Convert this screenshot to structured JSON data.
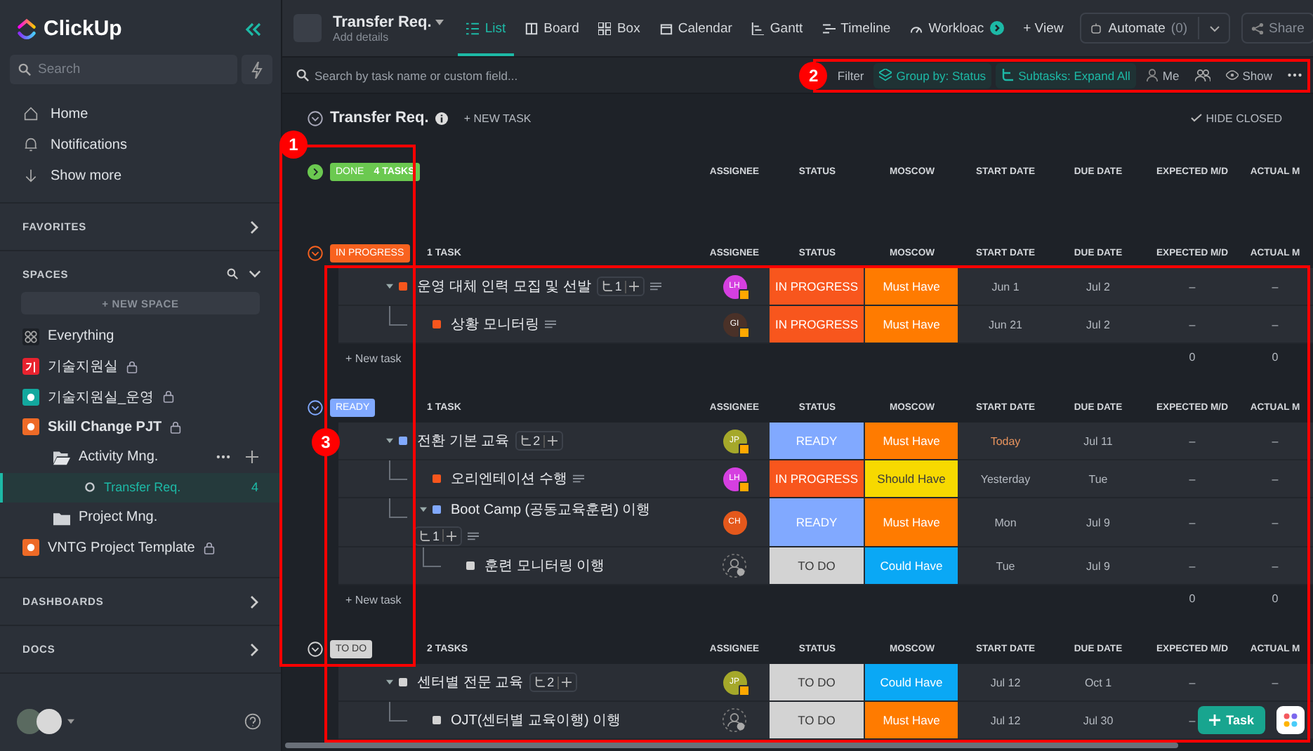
{
  "sidebar": {
    "logo": "ClickUp",
    "search": {
      "placeholder": "Search"
    },
    "nav": [
      {
        "label": "Home",
        "kind": "home"
      },
      {
        "label": "Notifications",
        "kind": "bell"
      },
      {
        "label": "Show more",
        "kind": "arrow"
      }
    ],
    "favorites": "FAVORITES",
    "spaces": {
      "title": "SPACES",
      "new_space": "+ NEW SPACE",
      "items": [
        {
          "kind": "everything",
          "label": "Everything",
          "locked": false,
          "selected": false,
          "hovered": false
        },
        {
          "kind": "space",
          "label": "기술지원실",
          "color": "#e8232f",
          "icon_text": "기",
          "locked": true,
          "selected": false,
          "hovered": false,
          "expanded": false
        },
        {
          "kind": "space",
          "label": "기술지원실_운영",
          "color": "#13a89e",
          "locked": true,
          "selected": false,
          "hovered": false,
          "expanded": false
        },
        {
          "kind": "space",
          "label": "Skill Change PJT",
          "color": "#ee6a27",
          "locked": true,
          "selected": false,
          "hovered": false,
          "expanded": true,
          "children": [
            {
              "kind": "folder",
              "label": "Activity Mng.",
              "locked": false,
              "selected": false,
              "hovered": true,
              "expanded": true,
              "children": [
                {
                  "kind": "list",
                  "label": "Transfer Req.",
                  "count": "4",
                  "locked": false,
                  "selected": true,
                  "hovered": false
                }
              ]
            },
            {
              "kind": "folder",
              "label": "Project Mng.",
              "locked": false,
              "selected": false,
              "hovered": false,
              "expanded": false
            }
          ]
        },
        {
          "kind": "space",
          "label": "VNTG Project Template",
          "color": "#ee6a27",
          "locked": true,
          "selected": false,
          "hovered": false,
          "expanded": false
        }
      ]
    },
    "sections": [
      "DASHBOARDS",
      "DOCS"
    ]
  },
  "topbar": {
    "title": "Transfer Req.",
    "subtitle": "Add details",
    "tabs": [
      {
        "label": "List",
        "kind": "list",
        "selected": true
      },
      {
        "label": "Board",
        "kind": "board",
        "selected": false
      },
      {
        "label": "Box",
        "kind": "box",
        "selected": false
      },
      {
        "label": "Calendar",
        "kind": "calendar",
        "selected": false
      },
      {
        "label": "Gantt",
        "kind": "gantt",
        "selected": false
      },
      {
        "label": "Timeline",
        "kind": "timeline",
        "selected": false
      },
      {
        "label": "Workloac",
        "kind": "workload",
        "selected": false
      }
    ],
    "add_view": "+ View",
    "automate": "Automate",
    "automate_count": "(0)",
    "share": "Share"
  },
  "toolbar": {
    "search": {
      "placeholder": "Search by task name or custom field..."
    },
    "filter": "Filter",
    "chips": [
      {
        "label": "Group by: Status",
        "kind": "group"
      },
      {
        "label": "Subtasks: Expand All",
        "kind": "subtasks"
      }
    ],
    "me": "Me",
    "show": "Show"
  },
  "list": {
    "title": "Transfer Req.",
    "new_task": "+ NEW TASK",
    "hide_closed": "HIDE CLOSED",
    "groups": [
      {
        "status": "DONE",
        "color": "#6bc950",
        "count": "4 TASKS",
        "expanded": false,
        "columns": [
          "ASSIGNEE",
          "STATUS",
          "MOSCOW",
          "START DATE",
          "DUE DATE",
          "EXPECTED M/D",
          "ACTUAL M"
        ]
      },
      {
        "status": "IN PROGRESS",
        "color": "#f8621f",
        "count": "1 TASK",
        "expanded": true,
        "columns": [
          "ASSIGNEE",
          "STATUS",
          "MOSCOW",
          "START DATE",
          "DUE DATE",
          "EXPECTED M/D",
          "ACTUAL M"
        ],
        "tasks": [
          {
            "name": "운영 대체 인력 모집 및 선발",
            "subtasks": "1",
            "has_description": true,
            "assignee": {
              "kind": "avatar",
              "initials": "LH",
              "color": "#d53fe0",
              "badge": true
            },
            "status": {
              "label": "IN PROGRESS",
              "color": "#f8561d"
            },
            "moscow": {
              "label": "Must Have",
              "color": "#ff7b00"
            },
            "start": "Jun 1",
            "start_highlighted": false,
            "due": "Jul 2",
            "expected": "–",
            "actual": "–",
            "children": [
              {
                "name": "상황 모니터링",
                "has_description": true,
                "assignee": {
                  "kind": "avatar",
                  "initials": "GI",
                  "color": "#4a3128",
                  "badge": true
                },
                "status": {
                  "label": "IN PROGRESS",
                  "color": "#f8561d"
                },
                "moscow": {
                  "label": "Must Have",
                  "color": "#ff7b00"
                },
                "start": "Jun 21",
                "start_highlighted": false,
                "due": "Jul 2",
                "expected": "–",
                "actual": "–"
              }
            ]
          }
        ],
        "footer": {
          "new_task": "+ New task",
          "totals": [
            "0",
            "0"
          ]
        }
      },
      {
        "status": "READY",
        "color": "#81a9ff",
        "count": "1 TASK",
        "expanded": true,
        "columns": [
          "ASSIGNEE",
          "STATUS",
          "MOSCOW",
          "START DATE",
          "DUE DATE",
          "EXPECTED M/D",
          "ACTUAL M"
        ],
        "tasks": [
          {
            "name": "전환 기본 교육",
            "subtasks": "2",
            "has_description": false,
            "assignee": {
              "kind": "avatar",
              "initials": "JP",
              "color": "#a5a82a",
              "badge": true
            },
            "status": {
              "label": "READY",
              "color": "#81a9ff"
            },
            "moscow": {
              "label": "Must Have",
              "color": "#ff7b00"
            },
            "start": "Today",
            "start_highlighted": true,
            "due": "Jul 11",
            "expected": "–",
            "actual": "–",
            "children": [
              {
                "name": "오리엔테이션 수행",
                "has_description": true,
                "assignee": {
                  "kind": "avatar",
                  "initials": "LH",
                  "color": "#d53fe0",
                  "badge": true
                },
                "status": {
                  "label": "IN PROGRESS",
                  "color": "#f8561d"
                },
                "moscow": {
                  "label": "Should Have",
                  "color": "#f7d900"
                },
                "start": "Yesterday",
                "start_highlighted": false,
                "due": "Tue",
                "expected": "–",
                "actual": "–"
              },
              {
                "name": "Boot Camp (공동교육훈련) 이행",
                "subtasks": "1",
                "has_description": true,
                "assignee": {
                  "kind": "avatar",
                  "initials": "CH",
                  "color": "#e4581c",
                  "badge": false
                },
                "status": {
                  "label": "READY",
                  "color": "#81a9ff"
                },
                "moscow": {
                  "label": "Must Have",
                  "color": "#ff7b00"
                },
                "start": "Mon",
                "start_highlighted": false,
                "due": "Jul 9",
                "expected": "–",
                "actual": "–",
                "children": [
                  {
                    "name": "훈련 모니터링 이행",
                    "has_description": false,
                    "assignee": {
                      "kind": "unassigned"
                    },
                    "status": {
                      "label": "TO DO",
                      "color": "#d3d3d3"
                    },
                    "moscow": {
                      "label": "Could Have",
                      "color": "#0aa8f5"
                    },
                    "start": "Tue",
                    "start_highlighted": false,
                    "due": "Jul 9",
                    "expected": "–",
                    "actual": "–"
                  }
                ]
              }
            ]
          }
        ],
        "footer": {
          "new_task": "+ New task",
          "totals": [
            "0",
            "0"
          ]
        }
      },
      {
        "status": "TO DO",
        "color": "#d3d3d3",
        "count": "2 TASKS",
        "expanded": true,
        "columns": [
          "ASSIGNEE",
          "STATUS",
          "MOSCOW",
          "START DATE",
          "DUE DATE",
          "EXPECTED M/D",
          "ACTUAL M"
        ],
        "tasks": [
          {
            "name": "센터별 전문 교육",
            "subtasks": "2",
            "has_description": false,
            "assignee": {
              "kind": "avatar",
              "initials": "JP",
              "color": "#a5a82a",
              "badge": true
            },
            "status": {
              "label": "TO DO",
              "color": "#d3d3d3"
            },
            "moscow": {
              "label": "Could Have",
              "color": "#0aa8f5"
            },
            "start": "Jul 12",
            "start_highlighted": false,
            "due": "Oct 1",
            "expected": "–",
            "actual": "–",
            "children": [
              {
                "name": "OJT(센터별 교육이행) 이행",
                "has_description": false,
                "assignee": {
                  "kind": "unassigned"
                },
                "status": {
                  "label": "TO DO",
                  "color": "#d3d3d3"
                },
                "moscow": {
                  "label": "Must Have",
                  "color": "#ff7b00"
                },
                "start": "Jul 12",
                "start_highlighted": false,
                "due": "Jul 30",
                "expected": "–"
              }
            ]
          }
        ]
      }
    ]
  },
  "task_button": "Task",
  "annotations": [
    {
      "label": "1"
    },
    {
      "label": "2"
    },
    {
      "label": "3"
    }
  ]
}
